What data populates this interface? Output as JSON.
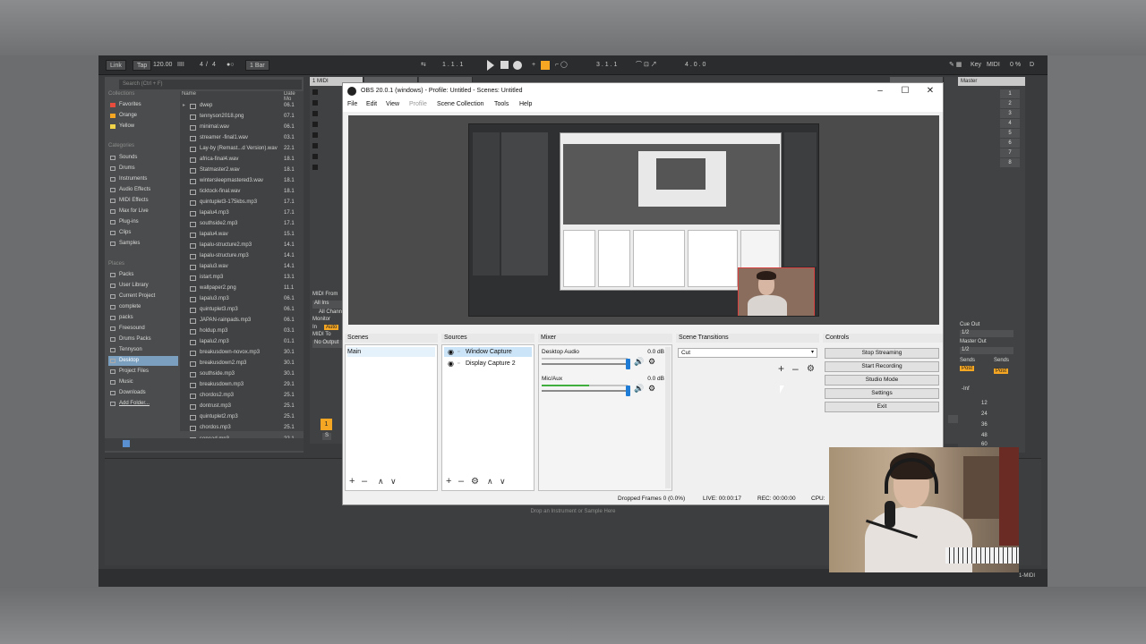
{
  "ableton": {
    "transport": {
      "link": "Link",
      "tap": "Tap",
      "tempo": "120.00",
      "meter_icon": "IIII",
      "time_sig_num": "4",
      "time_sig_den": "4",
      "quant": "1 Bar",
      "position": "1 .  1 .  1",
      "loop_start": "3 .  1 .  1",
      "loop_len": "4 .  0 .  0",
      "key": "Key",
      "midi": "MIDI",
      "cpu": "0 %",
      "d": "D"
    },
    "browser": {
      "search_placeholder": "Search (Ctrl + F)",
      "collections_header": "Collections",
      "collections": [
        {
          "label": "Favorites",
          "color": "#e84c3d"
        },
        {
          "label": "Orange",
          "color": "#f5a623"
        },
        {
          "label": "Yellow",
          "color": "#f1d34a"
        }
      ],
      "categories_header": "Categories",
      "categories": [
        "Sounds",
        "Drums",
        "Instruments",
        "Audio Effects",
        "MIDI Effects",
        "Max for Live",
        "Plug-ins",
        "Clips",
        "Samples"
      ],
      "places_header": "Places",
      "places": [
        "Packs",
        "User Library",
        "Current Project",
        "complete",
        "packs",
        "Freesound",
        "Drums Packs",
        "Tennyson",
        "Desktop",
        "Project Files",
        "Music",
        "Downloads",
        "Add Folder..."
      ],
      "selected_place": "Desktop",
      "col_name": "Name",
      "col_date": "Date Mo",
      "files": [
        {
          "name": "dwep",
          "date": "06.1"
        },
        {
          "name": "tennyson2018.png",
          "date": "07.1"
        },
        {
          "name": "minimal.wav",
          "date": "06.1"
        },
        {
          "name": "streamer -final1.wav",
          "date": "03.1"
        },
        {
          "name": "Lay-by (Remast...d Version).wav",
          "date": "22.1"
        },
        {
          "name": "africa-final4.wav",
          "date": "18.1"
        },
        {
          "name": "Statmaster2.wav",
          "date": "18.1"
        },
        {
          "name": "wintersleepmastered3.wav",
          "date": "18.1"
        },
        {
          "name": "ticktock-final.wav",
          "date": "18.1"
        },
        {
          "name": "quintuplet3-175kbs.mp3",
          "date": "17.1"
        },
        {
          "name": "lapalu4.mp3",
          "date": "17.1"
        },
        {
          "name": "southside2.mp3",
          "date": "17.1"
        },
        {
          "name": "lapalu4.wav",
          "date": "15.1"
        },
        {
          "name": "lapalu-structure2.mp3",
          "date": "14.1"
        },
        {
          "name": "lapalu-structure.mp3",
          "date": "14.1"
        },
        {
          "name": "lapalu3.wav",
          "date": "14.1"
        },
        {
          "name": "istart.mp3",
          "date": "13.1"
        },
        {
          "name": "wallpaper2.png",
          "date": "11.1"
        },
        {
          "name": "lapalu3.mp3",
          "date": "06.1"
        },
        {
          "name": "quintuplet3.mp3",
          "date": "06.1"
        },
        {
          "name": "JAPAN-rainpads.mp3",
          "date": "06.1"
        },
        {
          "name": "holdup.mp3",
          "date": "03.1"
        },
        {
          "name": "lapalu2.mp3",
          "date": "01.1"
        },
        {
          "name": "breakusdown-novox.mp3",
          "date": "30.1"
        },
        {
          "name": "breakusdown2.mp3",
          "date": "30.1"
        },
        {
          "name": "southside.mp3",
          "date": "30.1"
        },
        {
          "name": "breakusdown.mp3",
          "date": "29.1"
        },
        {
          "name": "chordos2.mp3",
          "date": "25.1"
        },
        {
          "name": "dontrust.mp3",
          "date": "25.1"
        },
        {
          "name": "quintuplet2.mp3",
          "date": "25.1"
        },
        {
          "name": "chordos.mp3",
          "date": "25.1"
        },
        {
          "name": "senead.mp3",
          "date": "22.1"
        }
      ]
    },
    "tracks": {
      "track1_name": "1 MIDI",
      "midi_from": "MIDI From",
      "all_ins": "All Ins",
      "all_channels": "All Chann",
      "monitor": "Monitor",
      "in": "In",
      "auto": "Auto",
      "midi_to": "MIDI To",
      "no_output": "No Output",
      "track_number": "1",
      "s_label": "S",
      "master": "Master",
      "scene_numbers": [
        "1",
        "2",
        "3",
        "4",
        "5",
        "6",
        "7",
        "8"
      ],
      "cue_out": "Cue Out",
      "cue_val": "1/2",
      "master_out": "Master Out",
      "master_out_val": "1/2",
      "sends": "Sends",
      "post": "Post",
      "inf": "-Inf",
      "db_scale": [
        "12",
        "24",
        "36",
        "48",
        "60"
      ]
    },
    "drop_hint": "Drop an Instrument or Sample Here",
    "status_track": "1-MIDI"
  },
  "obs": {
    "title": "OBS 20.0.1 (windows) - Profile: Untitled - Scenes: Untitled",
    "menu": [
      "File",
      "Edit",
      "View",
      "Profile",
      "Scene Collection",
      "Tools",
      "Help"
    ],
    "scenes_header": "Scenes",
    "scenes": [
      "Main"
    ],
    "sources_header": "Sources",
    "sources": [
      "Window Capture",
      "Display Capture 2"
    ],
    "mixer_header": "Mixer",
    "mixer": [
      {
        "name": "Desktop Audio",
        "db": "0.0 dB",
        "level": 0.0
      },
      {
        "name": "Mic/Aux",
        "db": "0.0 dB",
        "level": 0.55
      }
    ],
    "transitions_header": "Scene Transitions",
    "transition": "Cut",
    "controls_header": "Controls",
    "controls": [
      "Stop Streaming",
      "Start Recording",
      "Studio Mode",
      "Settings",
      "Exit"
    ],
    "status": {
      "dropped": "Dropped Frames 0 (0.0%)",
      "live": "LIVE: 00:00:17",
      "rec": "REC: 00:00:00",
      "cpu": "CPU:"
    }
  }
}
